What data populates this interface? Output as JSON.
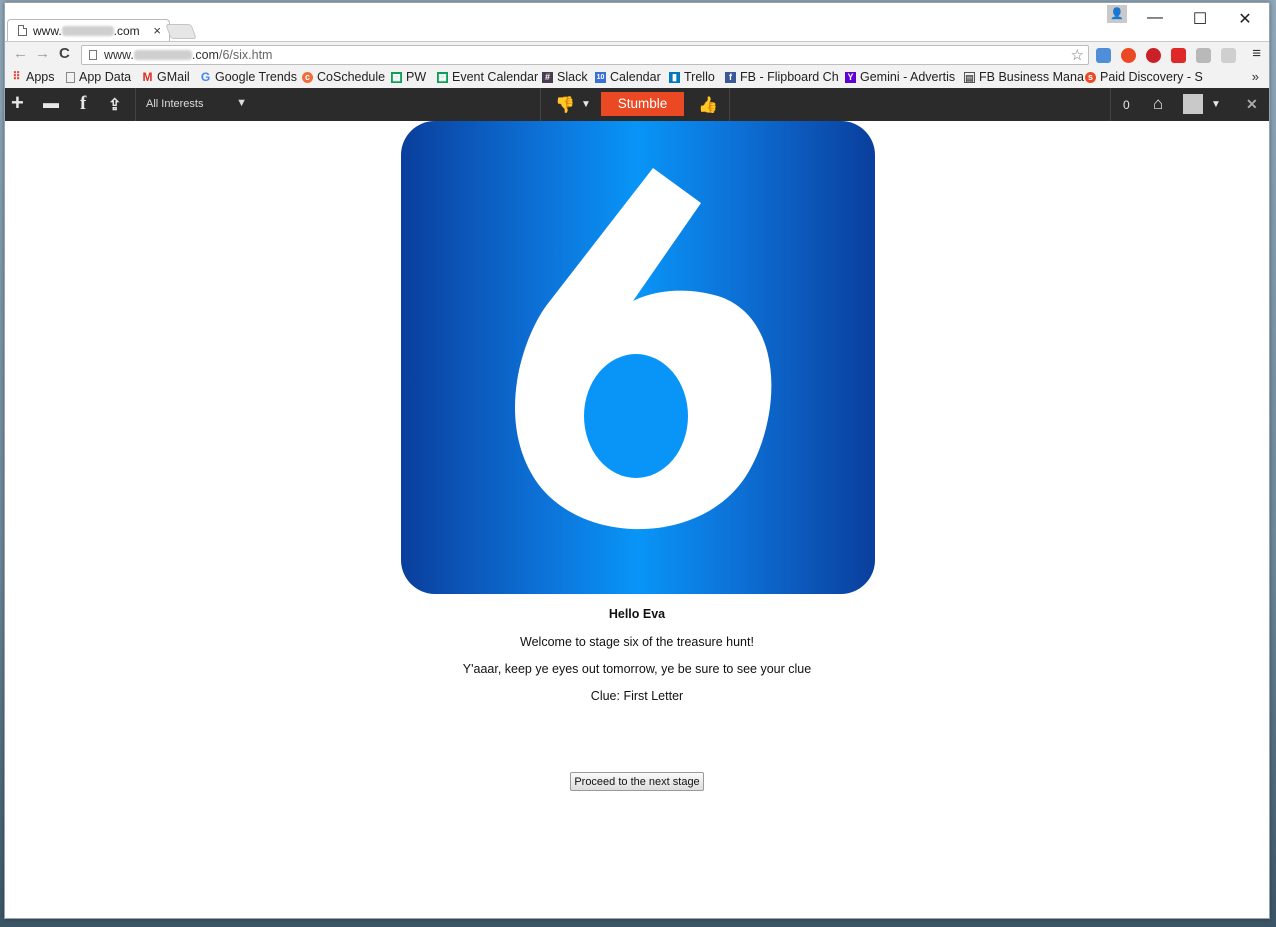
{
  "browser": {
    "tab_title_prefix": "www.",
    "tab_title_suffix": ".com",
    "tab_close": "×",
    "url_prefix": "www.",
    "url_domain_suffix": ".com",
    "url_path": "/6/six.htm",
    "window_controls": {
      "minimize": "—",
      "maximize": "☐",
      "close": "✕"
    }
  },
  "bookmarks": [
    {
      "label": "Apps",
      "icon": "apps-grid-icon",
      "color": "#e0483c"
    },
    {
      "label": "App Data",
      "icon": "page-icon",
      "color": "#888888"
    },
    {
      "label": "GMail",
      "icon": "gmail-icon",
      "color": "#d93025"
    },
    {
      "label": "Google Trends",
      "icon": "google-icon",
      "color": "#4285f4"
    },
    {
      "label": "CoSchedule",
      "icon": "coschedule-icon",
      "color": "#f26b3a"
    },
    {
      "label": "PW",
      "icon": "sheets-icon",
      "color": "#0f9d58"
    },
    {
      "label": "Event Calendar",
      "icon": "sheets-icon",
      "color": "#0f9d58"
    },
    {
      "label": "Slack",
      "icon": "slack-icon",
      "color": "#4a3c4f"
    },
    {
      "label": "Calendar",
      "icon": "calendar-icon",
      "color": "#3b6fd8"
    },
    {
      "label": "Trello",
      "icon": "trello-icon",
      "color": "#0079bf"
    },
    {
      "label": "FB - Flipboard Ch",
      "icon": "facebook-icon",
      "color": "#3b5998"
    },
    {
      "label": "Gemini - Advertis",
      "icon": "yahoo-icon",
      "color": "#5f01d1"
    },
    {
      "label": "FB Business Mana",
      "icon": "fb-business-icon",
      "color": "#555555"
    },
    {
      "label": "Paid Discovery - S",
      "icon": "stumbleupon-icon",
      "color": "#eb4924"
    }
  ],
  "bookmarks_more": "»",
  "stumblebar": {
    "interests": "All Interests",
    "stumble_label": "Stumble",
    "count": "0",
    "close": "✕"
  },
  "page": {
    "hero_digit": "6",
    "greeting": "Hello Eva",
    "welcome": "Welcome to stage six of the treasure hunt!",
    "hint": "Y'aaar, keep ye eyes out tomorrow, ye be sure to see your clue",
    "clue": "Clue: First Letter",
    "proceed_label": "Proceed to the next stage"
  },
  "colors": {
    "stumble_orange": "#eb4924",
    "hero_blue_light": "#0895f7",
    "hero_blue_dark": "#0a3e9c",
    "bar_dark": "#2b2b2b"
  }
}
